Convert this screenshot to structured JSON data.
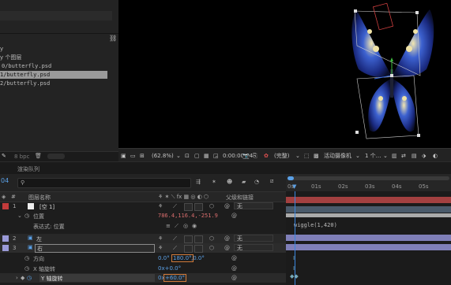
{
  "project": {
    "items": [
      "y",
      "y 个图层",
      "0/butterfly.psd",
      "1/butterfly.psd",
      "2/butterfly.psd"
    ],
    "bit_depth": "8 bpc"
  },
  "viewer": {
    "zoom": "(62.8%)",
    "timecode": "0:00:00:04",
    "resolution": "(完整)",
    "camera": "活动摄像机",
    "views": "1 个…"
  },
  "timeline": {
    "render_queue": "渲染队列",
    "current_time_short": "04",
    "search_placeholder": "",
    "col_layer_name": "图层名称",
    "col_parent": "父级和链接",
    "ruler_ticks": [
      "0s",
      "01s",
      "02s",
      "03s",
      "04s",
      "05s"
    ],
    "layers": [
      {
        "num": "1",
        "name": "[空 1]",
        "parent": "无",
        "color": "#c23b3b"
      },
      {
        "num": "2",
        "name": "左",
        "parent": "无",
        "color": "#9a9ad8"
      },
      {
        "num": "3",
        "name": "右",
        "parent": "无",
        "color": "#9a9ad8"
      }
    ],
    "position": {
      "label": "位置",
      "value": "786.4,116.4,-251.9"
    },
    "expression": {
      "label": "表达式: 位置",
      "code": "wiggle(1,420)"
    },
    "orientation": {
      "label": "方向",
      "v1": "0.0°",
      "v2": "180.0°",
      "v3": ",0.0°"
    },
    "x_rotation": {
      "label": "X 轴旋转",
      "v": "0x+0.0°"
    },
    "y_rotation": {
      "label": "Y 轴旋转",
      "v": "+60.0°",
      "prefix": "0x"
    }
  }
}
